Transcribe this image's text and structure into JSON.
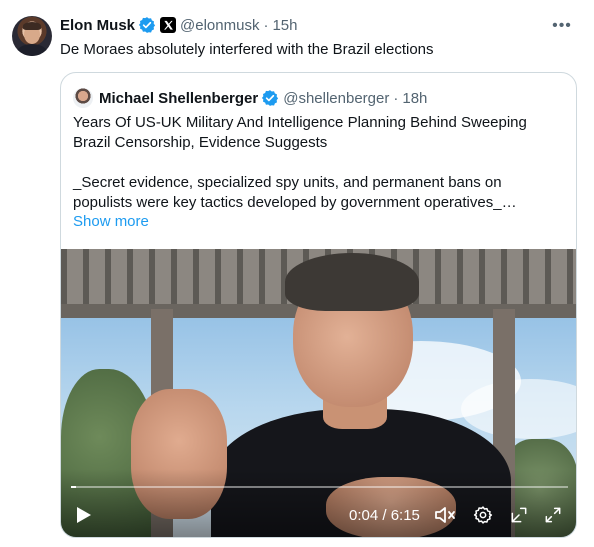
{
  "tweet": {
    "author_name": "Elon Musk",
    "handle": "@elonmusk",
    "separator": "·",
    "time": "15h",
    "more_label": "•••",
    "text": "De Moraes absolutely interfered with the Brazil elections"
  },
  "quote": {
    "author_name": "Michael Shellenberger",
    "handle": "@shellenberger",
    "separator": "·",
    "time": "18h",
    "title_line1": "Years Of US-UK Military And Intelligence Planning Behind Sweeping",
    "title_line2": "Brazil Censorship, Evidence Suggests",
    "body_line1": "_Secret evidence, specialized spy units, and permanent bans on",
    "body_line2": "populists were key tactics developed by government operatives_…",
    "show_more": "Show more"
  },
  "video": {
    "time_readout": "0:04 / 6:15",
    "progress_fraction": 0.011
  },
  "colors": {
    "verified_blue": "#1d9bf0",
    "link_blue": "#1d9bf0",
    "muted_text": "#536471",
    "border": "#cfd9de"
  },
  "icons": {
    "verified": "verified-badge-icon",
    "affiliate": "x-logo-icon",
    "more": "more-dots-icon",
    "play": "play-icon",
    "mute": "volume-muted-icon",
    "settings": "gear-icon",
    "popout": "picture-in-picture-icon",
    "fullscreen": "fullscreen-icon"
  }
}
